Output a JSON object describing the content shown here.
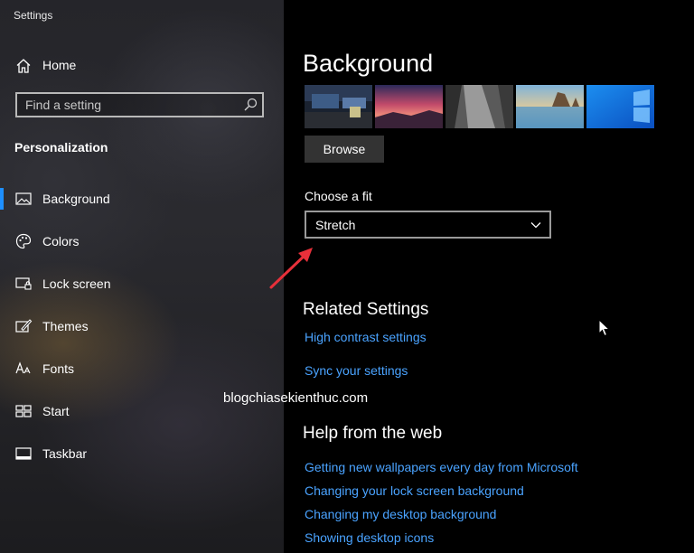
{
  "window": {
    "title": "Settings"
  },
  "sidebar": {
    "home_label": "Home",
    "search_placeholder": "Find a setting",
    "section_title": "Personalization",
    "items": [
      {
        "label": "Background",
        "icon": "picture-icon",
        "selected": true
      },
      {
        "label": "Colors",
        "icon": "palette-icon"
      },
      {
        "label": "Lock screen",
        "icon": "lock-screen-icon"
      },
      {
        "label": "Themes",
        "icon": "themes-icon"
      },
      {
        "label": "Fonts",
        "icon": "fonts-icon"
      },
      {
        "label": "Start",
        "icon": "start-icon"
      },
      {
        "label": "Taskbar",
        "icon": "taskbar-icon"
      }
    ]
  },
  "main": {
    "title": "Background",
    "browse_label": "Browse",
    "fit": {
      "label": "Choose a fit",
      "value": "Stretch"
    },
    "related": {
      "title": "Related Settings",
      "links": [
        "High contrast settings",
        "Sync your settings"
      ]
    },
    "help": {
      "title": "Help from the web",
      "links": [
        "Getting new wallpapers every day from Microsoft",
        "Changing your lock screen background",
        "Changing my desktop background",
        "Showing desktop icons"
      ]
    }
  },
  "watermark": "blogchiasekienthuc.com",
  "colors": {
    "accent": "#1e8fff",
    "link": "#4aa3ff",
    "annotation_arrow": "#e8303a"
  }
}
